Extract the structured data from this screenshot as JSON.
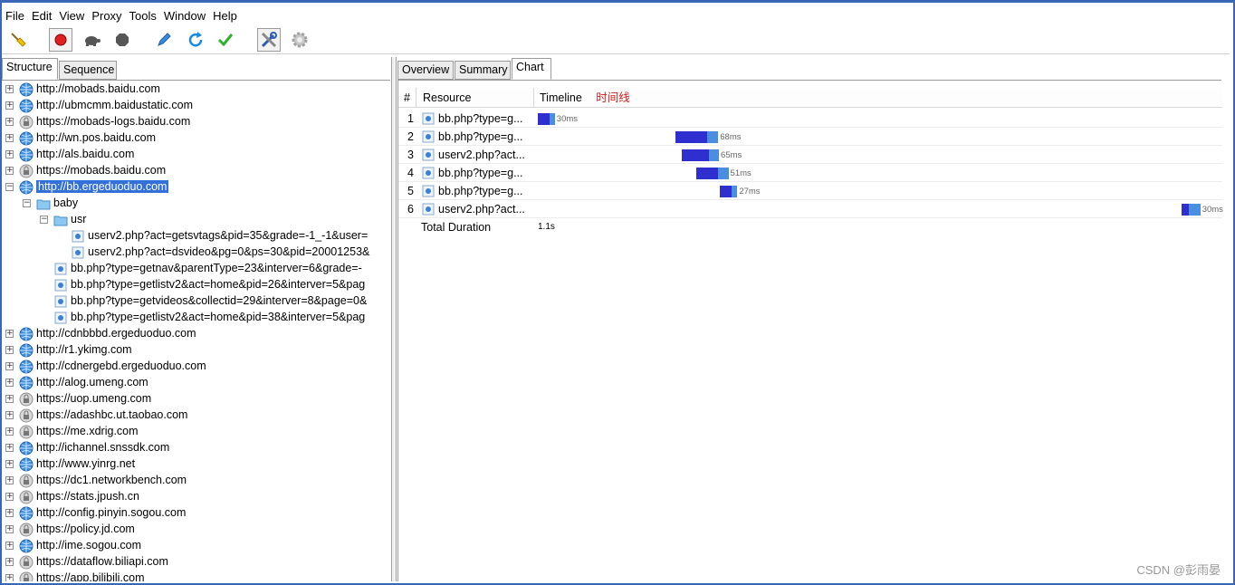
{
  "menu": [
    "File",
    "Edit",
    "View",
    "Proxy",
    "Tools",
    "Window",
    "Help"
  ],
  "toolbar_icons": [
    "broom-icon",
    "record-icon",
    "turtle-icon",
    "stop-hexagon-icon",
    "pen-icon",
    "refresh-icon",
    "checkmark-icon",
    "tools-icon",
    "settings-gear-icon"
  ],
  "left_tabs": [
    "Structure",
    "Sequence"
  ],
  "right_tabs": [
    "Overview",
    "Summary",
    "Chart"
  ],
  "tree": [
    {
      "label": "http://mobads.baidu.com",
      "kind": "globe"
    },
    {
      "label": "http://ubmcmm.baidustatic.com",
      "kind": "globe"
    },
    {
      "label": "https://mobads-logs.baidu.com",
      "kind": "lock"
    },
    {
      "label": "http://wn.pos.baidu.com",
      "kind": "globe"
    },
    {
      "label": "http://als.baidu.com",
      "kind": "globe"
    },
    {
      "label": "https://mobads.baidu.com",
      "kind": "lock"
    },
    {
      "label": "http://bb.ergeduoduo.com",
      "kind": "globe",
      "selected": true,
      "expanded": true
    },
    {
      "label": "baby",
      "kind": "folder"
    },
    {
      "label": "usr",
      "kind": "folder"
    },
    {
      "label": "userv2.php?act=getsvtags&pid=35&grade=-1_-1&user=",
      "kind": "file"
    },
    {
      "label": "userv2.php?act=dsvideo&pg=0&ps=30&pid=20001253&",
      "kind": "file"
    },
    {
      "label": "bb.php?type=getnav&parentType=23&interver=6&grade=-",
      "kind": "file"
    },
    {
      "label": "bb.php?type=getlistv2&act=home&pid=26&interver=5&pag",
      "kind": "file"
    },
    {
      "label": "bb.php?type=getvideos&collectid=29&interver=8&page=0&",
      "kind": "file"
    },
    {
      "label": "bb.php?type=getlistv2&act=home&pid=38&interver=5&pag",
      "kind": "file"
    },
    {
      "label": "http://cdnbbbd.ergeduoduo.com",
      "kind": "globe"
    },
    {
      "label": "http://r1.ykimg.com",
      "kind": "globe"
    },
    {
      "label": "http://cdnergebd.ergeduoduo.com",
      "kind": "globe"
    },
    {
      "label": "http://alog.umeng.com",
      "kind": "globe"
    },
    {
      "label": "https://uop.umeng.com",
      "kind": "lock"
    },
    {
      "label": "https://adashbc.ut.taobao.com",
      "kind": "lock"
    },
    {
      "label": "https://me.xdrig.com",
      "kind": "lock"
    },
    {
      "label": "http://ichannel.snssdk.com",
      "kind": "globe"
    },
    {
      "label": "http://www.yinrg.net",
      "kind": "globe"
    },
    {
      "label": "https://dc1.networkbench.com",
      "kind": "lock"
    },
    {
      "label": "https://stats.jpush.cn",
      "kind": "lock"
    },
    {
      "label": "http://config.pinyin.sogou.com",
      "kind": "globe"
    },
    {
      "label": "https://policy.jd.com",
      "kind": "lock"
    },
    {
      "label": "http://ime.sogou.com",
      "kind": "globe"
    },
    {
      "label": "https://dataflow.biliapi.com",
      "kind": "lock"
    },
    {
      "label": "https://app.bilibili.com",
      "kind": "lock"
    }
  ],
  "chart": {
    "headers": {
      "num": "#",
      "resource": "Resource",
      "timeline": "Timeline"
    },
    "annotation": "时间线",
    "rows": [
      {
        "num": "1",
        "resource": "bb.php?type=g...",
        "duration": "30ms",
        "start_fraction": 0.0,
        "wait_fraction": 0.017,
        "recv_fraction": 0.008
      },
      {
        "num": "2",
        "resource": "bb.php?type=g...",
        "duration": "68ms",
        "start_fraction": 0.202,
        "wait_fraction": 0.047,
        "recv_fraction": 0.016
      },
      {
        "num": "3",
        "resource": "userv2.php?act...",
        "duration": "65ms",
        "start_fraction": 0.212,
        "wait_fraction": 0.039,
        "recv_fraction": 0.015
      },
      {
        "num": "4",
        "resource": "bb.php?type=g...",
        "duration": "51ms",
        "start_fraction": 0.233,
        "wait_fraction": 0.031,
        "recv_fraction": 0.016
      },
      {
        "num": "5",
        "resource": "bb.php?type=g...",
        "duration": "27ms",
        "start_fraction": 0.267,
        "wait_fraction": 0.017,
        "recv_fraction": 0.009
      },
      {
        "num": "6",
        "resource": "userv2.php?act...",
        "duration": "30ms",
        "start_fraction": 0.946,
        "wait_fraction": 0.01,
        "recv_fraction": 0.017
      }
    ],
    "total_label": "Total Duration",
    "total_value": "1.1s"
  },
  "watermark": "CSDN @彭雨晏",
  "colors": {
    "selection": "#3370d8",
    "bar_wait": "#2f2fcf",
    "bar_receive": "#4a8ee0",
    "annotation": "#d01b1b"
  }
}
